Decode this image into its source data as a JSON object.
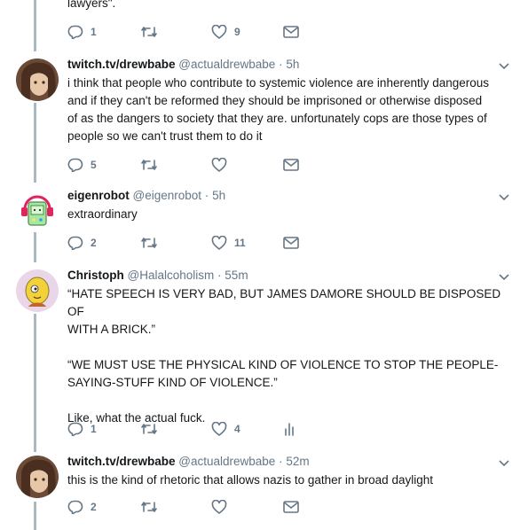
{
  "top": {
    "text_fragment": "lawyers\".",
    "reply_count": "1",
    "retweet_count": "",
    "like_count": "9"
  },
  "tweets": [
    {
      "name": "twitch.tv/drewbabe",
      "handle": "@actualdrewbabe",
      "time": "5h",
      "text": [
        "i think that people who contribute to systemic violence are inherently dangerous",
        "and if they can't be reformed they should be imprisoned or otherwise disposed",
        "of as the dangers to society that they are. unfortunately cops are those types of",
        "people so we can't trust them to do it"
      ],
      "reply_count": "5",
      "retweet_count": "",
      "like_count": ""
    },
    {
      "name": "eigenrobot",
      "handle": "@eigenrobot",
      "time": "5h",
      "text": [
        "extraordinary"
      ],
      "reply_count": "2",
      "retweet_count": "",
      "like_count": "11"
    },
    {
      "name": "Christoph",
      "handle": "@Halalcoholism",
      "time": "55m",
      "text": [
        "“HATE SPEECH IS VERY BAD, BUT JAMES DAMORE SHOULD BE DISPOSED OF",
        "WITH A BRICK.”",
        "",
        "“WE MUST USE THE PHYSICAL KIND OF VIOLENCE TO STOP THE PEOPLE-",
        "SAYING-STUFF KIND OF VIOLENCE.”",
        "",
        "Like, what the actual fuck."
      ],
      "reply_count": "1",
      "retweet_count": "",
      "like_count": "4"
    },
    {
      "name": "twitch.tv/drewbabe",
      "handle": "@actualdrewbabe",
      "time": "52m",
      "text": [
        "this is the kind of rhetoric that allows nazis to gather in broad daylight"
      ],
      "reply_count": "2",
      "retweet_count": "",
      "like_count": ""
    }
  ],
  "dot": "·",
  "colors": {
    "icon": "#657786",
    "thread": "#aab8c2",
    "name": "#14171a"
  },
  "icons": [
    "reply-icon",
    "retweet-icon",
    "like-icon",
    "direct-message-icon",
    "analytics-icon",
    "caret-down-icon"
  ]
}
